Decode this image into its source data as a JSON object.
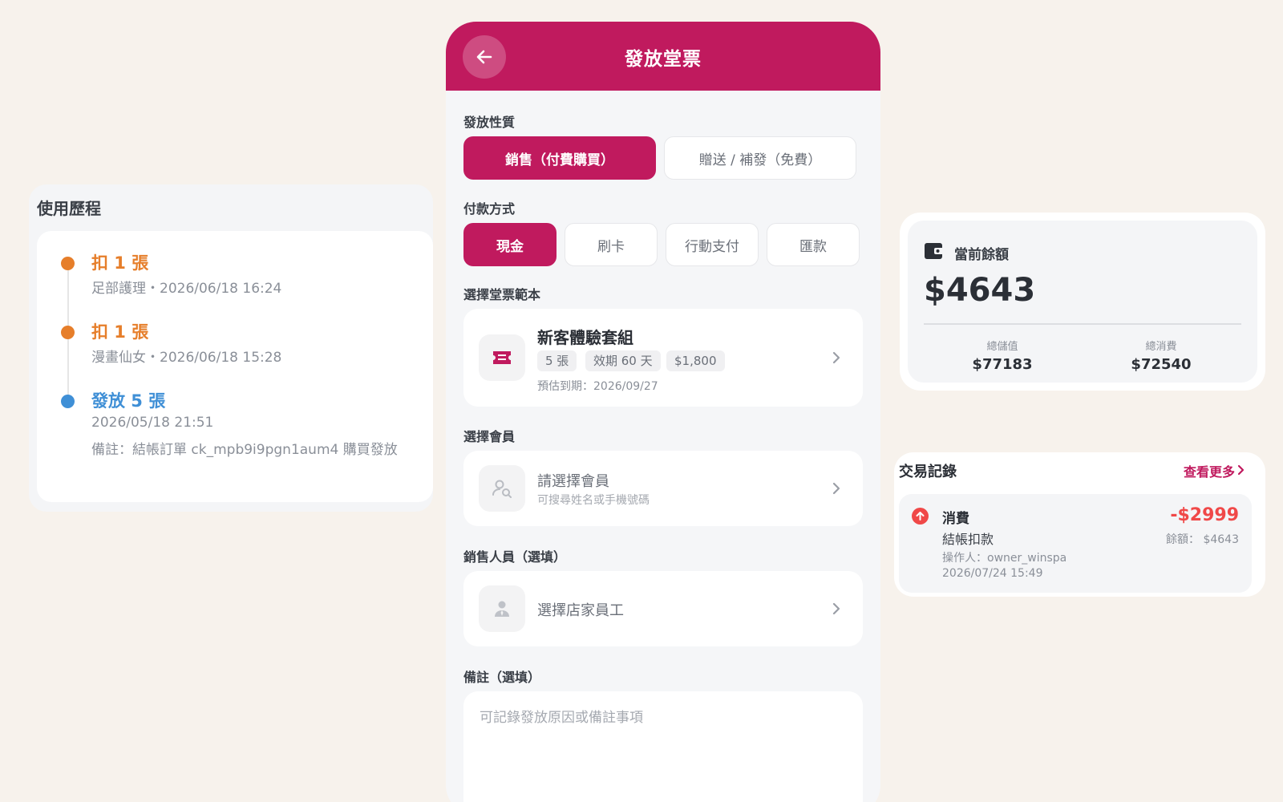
{
  "history": {
    "title": "使用歷程",
    "items": [
      {
        "headline": "扣 1 張",
        "line1": "足部護理・2026/06/18 16:24",
        "line2": ""
      },
      {
        "headline": "扣 1 張",
        "line1": "漫畫仙女・2026/06/18 15:28",
        "line2": ""
      },
      {
        "headline": "發放 5 張",
        "line1": "2026/05/18 21:51",
        "line2": "備註：結帳訂單 ck_mpb9i9pgn1aum4 購買發放"
      }
    ],
    "colors": {
      "deduct": "#e67e2a",
      "issue": "#3f8fd6"
    }
  },
  "form": {
    "title": "發放堂票",
    "back_icon": "arrow-left-icon",
    "accent": "#c01a5e",
    "issue_type": {
      "label": "發放性質",
      "options": [
        "銷售（付費購買）",
        "贈送 / 補發（免費）"
      ],
      "selected": "銷售（付費購買）"
    },
    "payment": {
      "label": "付款方式",
      "options": [
        "現金",
        "刷卡",
        "行動支付",
        "匯款"
      ],
      "selected": "現金"
    },
    "template": {
      "label": "選擇堂票範本",
      "icon": "ticket-icon",
      "name": "新客體驗套組",
      "chips": [
        "5 張",
        "效期 60 天",
        "$1,800"
      ],
      "expiry": "預估到期：2026/09/27"
    },
    "member": {
      "label": "選擇會員",
      "icon": "user-search-icon",
      "placeholder": "請選擇會員",
      "hint": "可搜尋姓名或手機號碼"
    },
    "staff": {
      "label": "銷售人員（選填）",
      "icon": "staff-icon",
      "placeholder": "選擇店家員工"
    },
    "notes": {
      "label": "備註（選填）",
      "placeholder": "可記錄發放原因或備註事項"
    }
  },
  "balance": {
    "icon": "wallet-icon",
    "title": "當前餘額",
    "amount": "$4643",
    "total_topup_label": "總儲值",
    "total_topup": "$77183",
    "total_spend_label": "總消費",
    "total_spend": "$72540"
  },
  "transactions": {
    "title": "交易記錄",
    "more_label": "查看更多",
    "items": [
      {
        "type": "消費",
        "description": "結帳扣款",
        "operator": "操作人：owner_winspa",
        "time": "2026/07/24 15:49",
        "amount": "-$2999",
        "balance_after": "餘額： $4643"
      }
    ],
    "negative_color": "#f04848"
  }
}
